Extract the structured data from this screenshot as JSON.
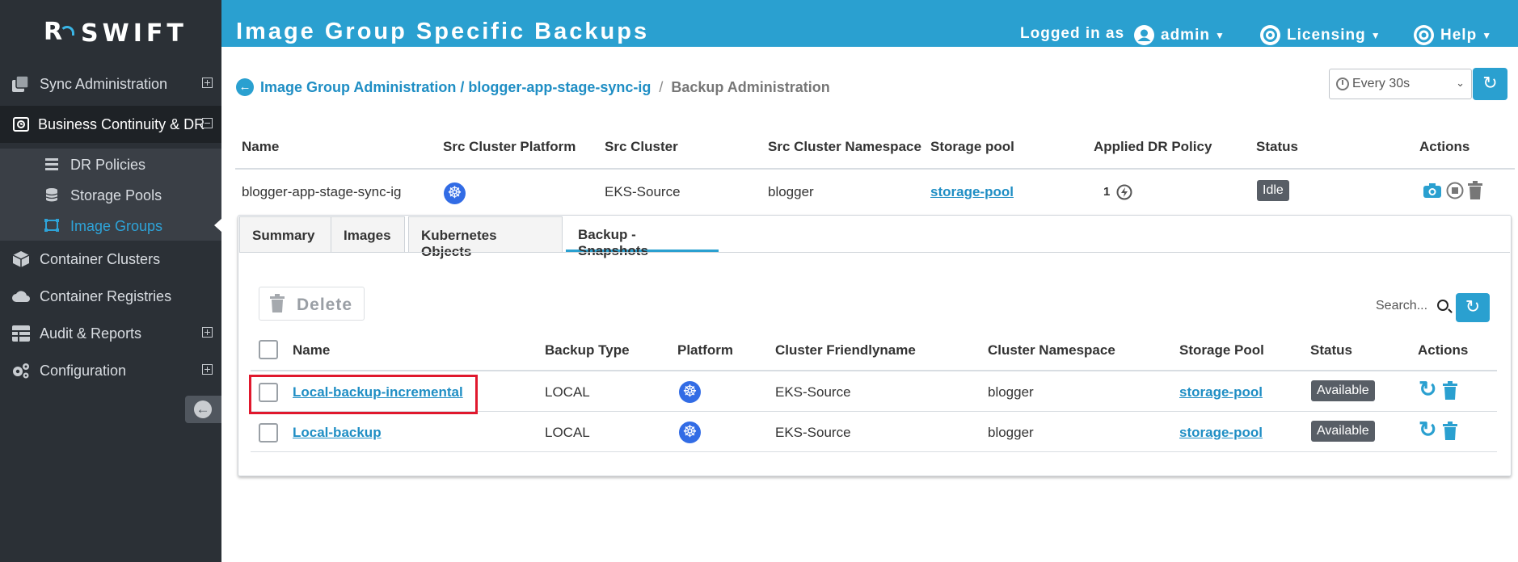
{
  "app": {
    "brand": "SWIFT"
  },
  "header": {
    "title": "Image Group Specific Backups",
    "logged_in_label": "Logged in as",
    "user": "admin",
    "licensing": "Licensing",
    "help": "Help"
  },
  "sidebar": {
    "items": [
      {
        "label": "Sync Administration"
      },
      {
        "label": "Business Continuity & DR"
      },
      {
        "label": "DR Policies"
      },
      {
        "label": "Storage Pools"
      },
      {
        "label": "Image Groups"
      },
      {
        "label": "Container Clusters"
      },
      {
        "label": "Container Registries"
      },
      {
        "label": "Audit & Reports"
      },
      {
        "label": "Configuration"
      }
    ]
  },
  "breadcrumb": {
    "link": "Image Group Administration / blogger-app-stage-sync-ig",
    "separator": "/",
    "current": "Backup Administration"
  },
  "refresh": {
    "interval": "Every 30s"
  },
  "group_table": {
    "headers": [
      "Name",
      "Src Cluster Platform",
      "Src Cluster",
      "Src Cluster Namespace",
      "Storage pool",
      "Applied DR Policy",
      "Status",
      "Actions"
    ],
    "row": {
      "name": "blogger-app-stage-sync-ig",
      "platform": "kubernetes",
      "src_cluster": "EKS-Source",
      "namespace": "blogger",
      "storage_pool": "storage-pool",
      "dr_policy": "1",
      "status": "Idle"
    }
  },
  "tabs": [
    {
      "label": "Summary"
    },
    {
      "label": "Images"
    },
    {
      "label": "Kubernetes Objects"
    },
    {
      "label": "Backup - Snapshots",
      "active": true
    }
  ],
  "snapshots": {
    "delete_label": "Delete",
    "search_placeholder": "Search...",
    "headers": [
      "Name",
      "Backup Type",
      "Platform",
      "Cluster Friendlyname",
      "Cluster Namespace",
      "Storage Pool",
      "Status",
      "Actions"
    ],
    "rows": [
      {
        "name": "Local-backup-incremental",
        "type": "LOCAL",
        "platform": "kubernetes",
        "cluster": "EKS-Source",
        "namespace": "blogger",
        "storage_pool": "storage-pool",
        "status": "Available"
      },
      {
        "name": "Local-backup",
        "type": "LOCAL",
        "platform": "kubernetes",
        "cluster": "EKS-Source",
        "namespace": "blogger",
        "storage_pool": "storage-pool",
        "status": "Available"
      }
    ]
  },
  "colors": {
    "accent": "#2aa0d0",
    "sidebar": "#2b3036",
    "link": "#1f8ec4",
    "badge": "#585e66",
    "highlight": "#e0182d",
    "k8s": "#326ce5"
  },
  "icons": [
    "r-swift-logo",
    "sync-icon",
    "business-continuity-icon",
    "list-icon",
    "database-icon",
    "image-groups-icon",
    "cube-icon",
    "cloud-icon",
    "grid-icon",
    "gears-icon",
    "collapse-icon",
    "user-icon",
    "licensing-icon",
    "help-icon",
    "back-icon",
    "clock-icon",
    "refresh-icon",
    "kubernetes-icon",
    "bolt-icon",
    "camera-icon",
    "stop-icon",
    "trash-icon",
    "search-icon",
    "restore-icon"
  ]
}
